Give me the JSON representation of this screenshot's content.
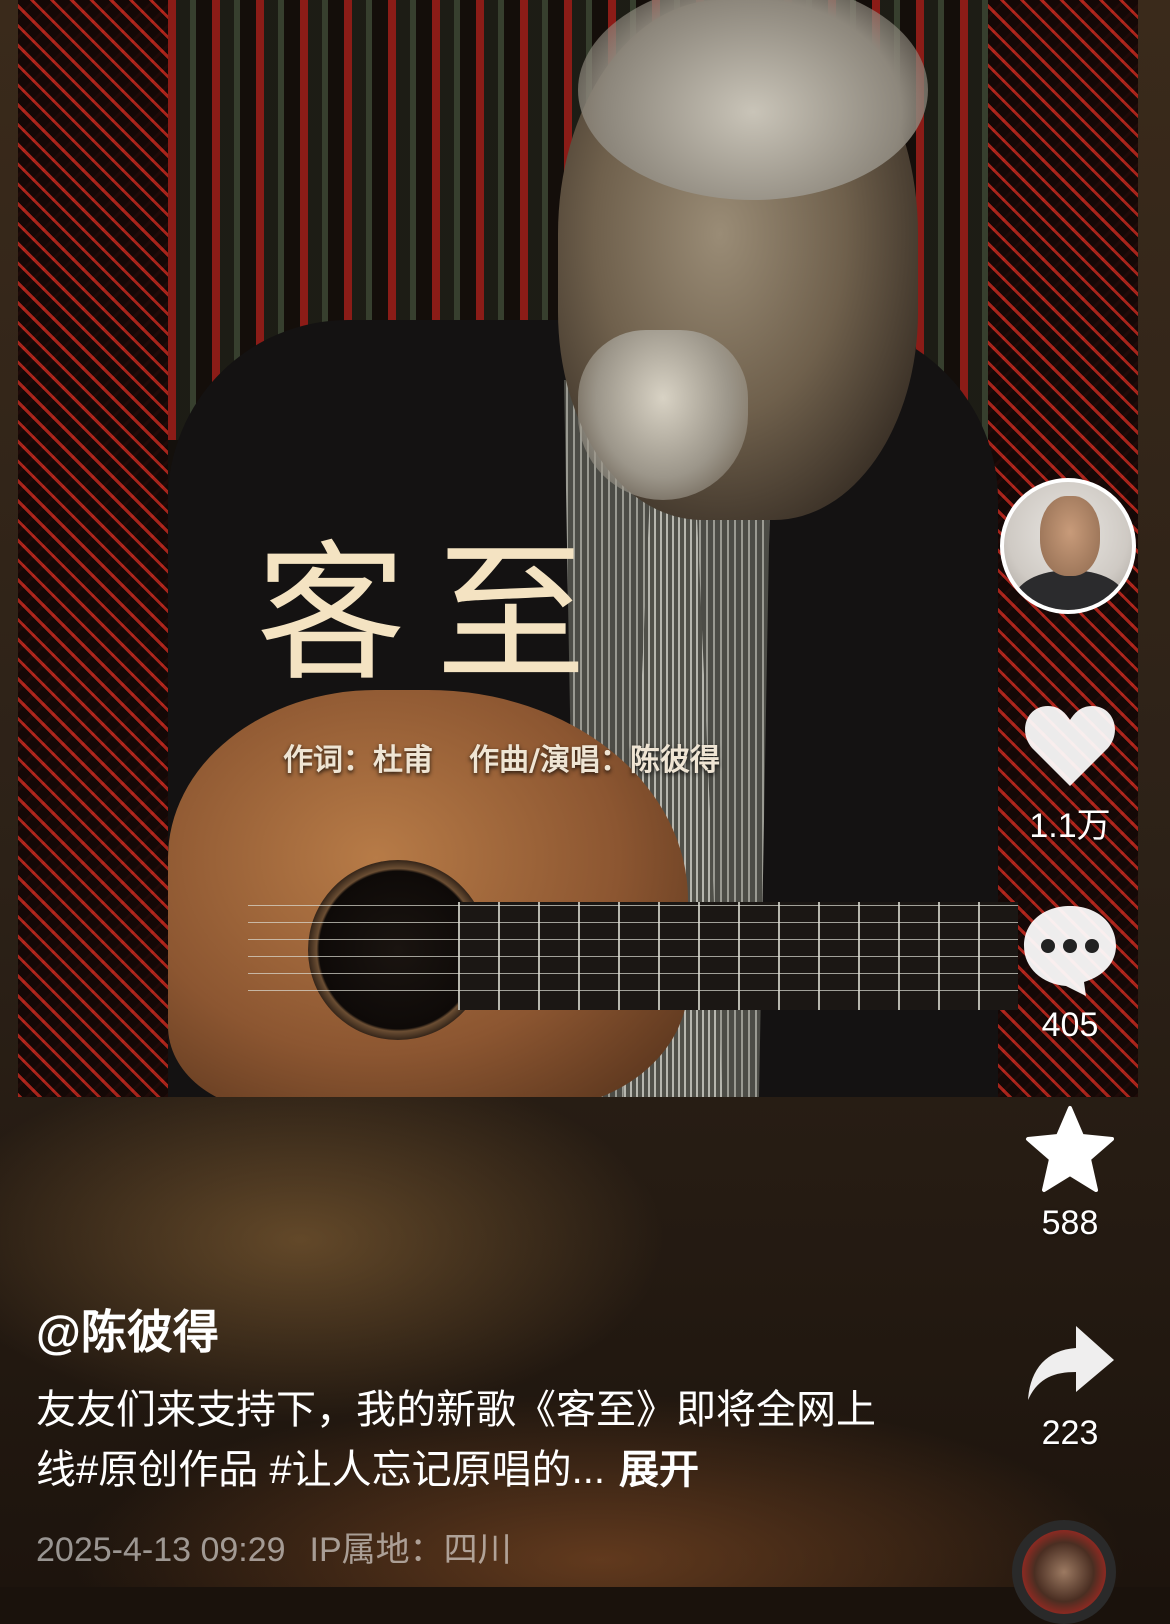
{
  "video": {
    "song_title": "客至",
    "credits_lyrics": "作词：杜甫",
    "credits_music": "作曲/演唱：陈彼得"
  },
  "actions": {
    "like_count": "1.1万",
    "comment_count": "405",
    "favorite_count": "588",
    "share_count": "223",
    "icons": [
      "avatar",
      "heart-icon",
      "comment-icon",
      "star-icon",
      "share-icon"
    ]
  },
  "post": {
    "author": "@陈彼得",
    "description": "友友们来支持下，我的新歌《客至》即将全网上线#原创作品 #让人忘记原唱的...",
    "expand_label": "展开",
    "timestamp": "2025-4-13 09:29",
    "ip_location": "IP属地：四川"
  }
}
